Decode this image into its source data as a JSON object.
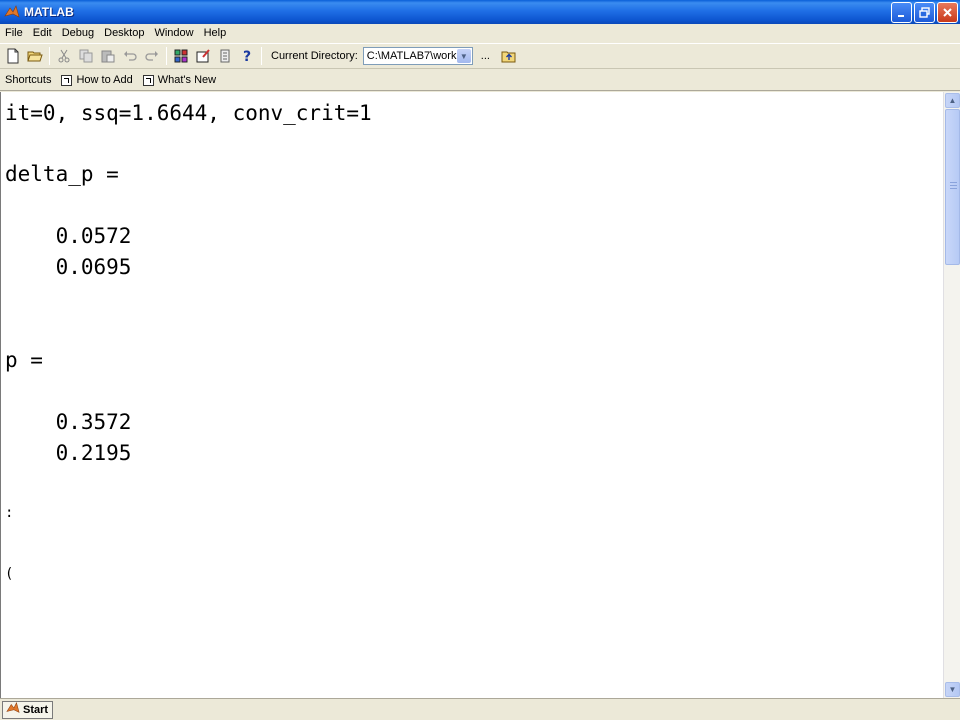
{
  "window": {
    "title": "MATLAB",
    "icon": "matlab-logo-icon"
  },
  "menu": [
    "File",
    "Edit",
    "Debug",
    "Desktop",
    "Window",
    "Help"
  ],
  "toolbar": {
    "current_directory_label": "Current Directory:",
    "current_directory_value": "C:\\MATLAB7\\work",
    "browse_label": "..."
  },
  "shortcuts": {
    "label": "Shortcuts",
    "items": [
      "How to Add",
      "What's New"
    ]
  },
  "command_window": {
    "lines": [
      "it=0, ssq=1.6644, conv_crit=1",
      "delta_p =",
      "    0.0572",
      "    0.0695",
      "p =",
      "    0.3572",
      "    0.2195"
    ],
    "partial_chars": [
      ":",
      "("
    ]
  },
  "statusbar": {
    "start_label": "Start"
  },
  "colors": {
    "titlebar": "#1f6fe6",
    "chrome": "#ece9d8",
    "console_bg": "#ffffff"
  }
}
